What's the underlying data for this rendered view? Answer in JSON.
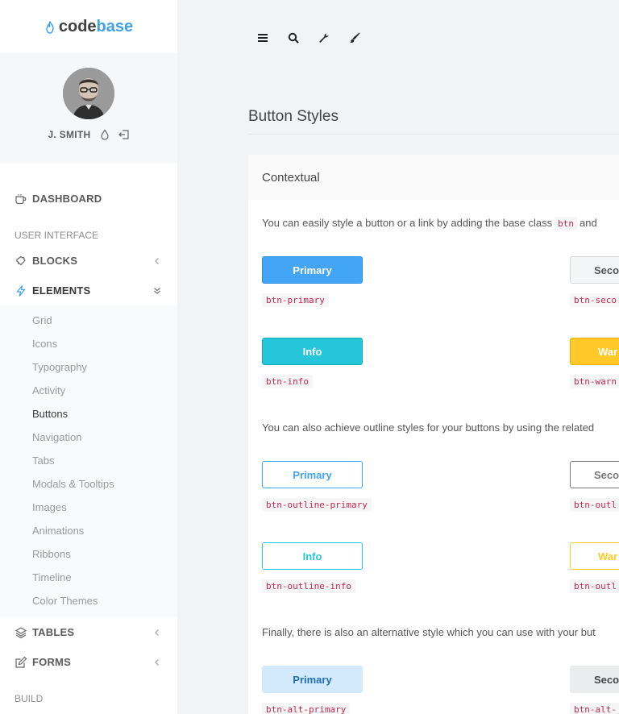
{
  "brand": {
    "code": "code",
    "base": "base"
  },
  "user": {
    "name": "J. SMITH"
  },
  "nav": {
    "dashboard": "DASHBOARD",
    "heading_ui": "USER INTERFACE",
    "blocks": "BLOCKS",
    "elements": "ELEMENTS",
    "elements_sub": [
      "Grid",
      "Icons",
      "Typography",
      "Activity",
      "Buttons",
      "Navigation",
      "Tabs",
      "Modals & Tooltips",
      "Images",
      "Animations",
      "Ribbons",
      "Timeline",
      "Color Themes"
    ],
    "active_sub": "Buttons",
    "tables": "TABLES",
    "forms": "FORMS",
    "heading_build": "BUILD"
  },
  "page": {
    "title": "Button Styles",
    "block_title": "Contextual",
    "desc1_before": "You can easily style a button or a link by adding the base class",
    "desc1_code": "btn",
    "desc1_after": "and",
    "desc2": "You can also achieve outline styles for your buttons by using the related",
    "desc3": "Finally, there is also an alternative style which you can use with your but"
  },
  "buttons": {
    "primary": "Primary",
    "secondary": "Secon",
    "info": "Info",
    "warning": "War",
    "o_primary": "Primary",
    "o_secondary": "Secon",
    "o_info": "Info",
    "o_warning": "War",
    "alt_primary": "Primary",
    "alt_secondary": "Secon"
  },
  "classes": {
    "primary": "btn-primary",
    "secondary": "btn-seco",
    "info": "btn-info",
    "warning": "btn-warn",
    "o_primary": "btn-outline-primary",
    "o_secondary": "btn-outl",
    "o_info": "btn-outline-info",
    "o_warning": "btn-outl",
    "alt_primary": "btn-alt-primary",
    "alt_secondary": "btn-alt-"
  },
  "colors": {
    "primary": "#42a5f5",
    "info": "#26c6da",
    "warning": "#ffca28",
    "brand_accent": "#3fa2e8"
  },
  "icons": {
    "toolbar": [
      "menu-icon",
      "search-icon",
      "wrench-icon",
      "paintbrush-icon"
    ],
    "user": [
      "droplet-icon",
      "logout-icon"
    ]
  }
}
